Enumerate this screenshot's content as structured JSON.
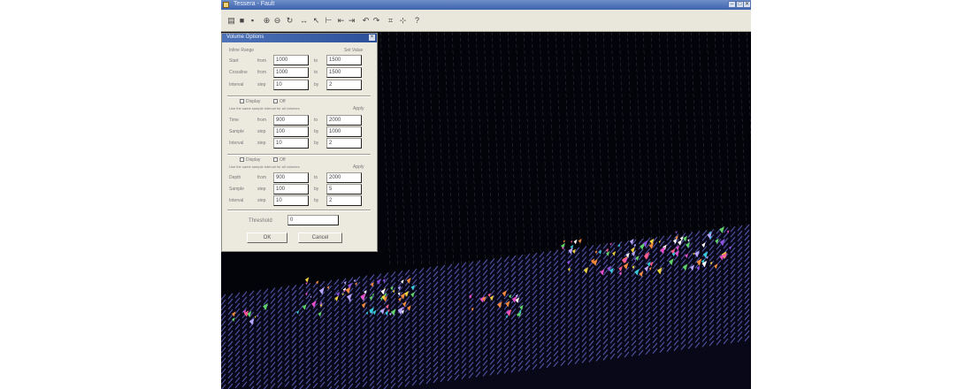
{
  "window": {
    "title": "Tessera - Fault",
    "minimize_glyph": "–",
    "maximize_glyph": "□",
    "close_glyph": "✕"
  },
  "toolbar": {
    "icons": [
      "open-icon",
      "save-icon",
      "print-icon",
      "zoom-in-icon",
      "zoom-out-icon",
      "rotate-icon",
      "pan-icon",
      "select-icon",
      "measure-icon",
      "arrow-left-icon",
      "arrow-right-icon",
      "undo-icon",
      "redo-icon",
      "grid-icon",
      "axis-icon",
      "help-icon"
    ],
    "glyphs": [
      "▤",
      "■",
      "▪",
      "⊕",
      "⊖",
      "↻",
      "↔",
      "↖",
      "⊢",
      "⇤",
      "⇥",
      "↶",
      "↷",
      "⌗",
      "⊹",
      "?"
    ]
  },
  "dialog": {
    "title": "Volume Options",
    "section1": {
      "header_left": "Inline Range",
      "header_right": "Set Value",
      "rows": [
        {
          "label": "Start",
          "unit": "from",
          "value": "1000",
          "unit2": "to",
          "value2": "1500"
        },
        {
          "label": "Crossline",
          "unit": "from",
          "value": "1000",
          "unit2": "to",
          "value2": "1500"
        },
        {
          "label": "Interval",
          "unit": "step",
          "value": "10",
          "unit2": "by",
          "value2": "2"
        }
      ]
    },
    "section2": {
      "check_label": "Display",
      "check2_label": "Off",
      "note": "Use the same sample interval for all volumes",
      "apply_label": "Apply",
      "rows": [
        {
          "label": "Time",
          "unit": "from",
          "value": "900",
          "unit2": "to",
          "value2": "2000"
        },
        {
          "label": "Sample",
          "unit": "step",
          "value": "100",
          "unit2": "by",
          "value2": "1000"
        },
        {
          "label": "Interval",
          "unit": "step",
          "value": "10",
          "unit2": "by",
          "value2": "2"
        }
      ]
    },
    "section3": {
      "check_label": "Display",
      "check2_label": "Off",
      "note": "Use the same sample interval for all volumes",
      "apply_label": "Apply",
      "rows": [
        {
          "label": "Depth",
          "unit": "from",
          "value": "900",
          "unit2": "to",
          "value2": "2000"
        },
        {
          "label": "Sample",
          "unit": "step",
          "value": "100",
          "unit2": "by",
          "value2": "5"
        },
        {
          "label": "Interval",
          "unit": "step",
          "value": "10",
          "unit2": "by",
          "value2": "2"
        }
      ]
    },
    "threshold_label": "Threshold",
    "threshold_value": "0",
    "ok_label": "OK",
    "cancel_label": "Cancel"
  },
  "viewport": {
    "background_color": "#03030a",
    "grid_color": "#5a5a66",
    "surface_color": "#4d4f9a",
    "fault_colors": [
      "#e84ec9",
      "#36c9d8",
      "#f0d23b",
      "#ffffff",
      "#8e53e0",
      "#f58a3c",
      "#5fd36a",
      "#ff5b8c",
      "#b8a6ff"
    ]
  }
}
